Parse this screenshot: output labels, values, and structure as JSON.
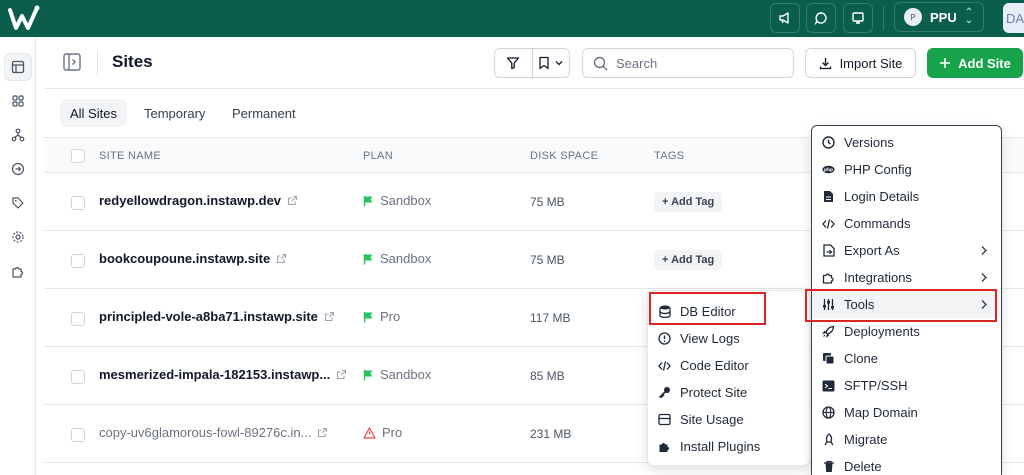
{
  "topbar": {
    "user_initial": "P",
    "user_name": "PPU",
    "second_chip": "DA"
  },
  "header": {
    "title": "Sites",
    "search_placeholder": "Search",
    "import_label": "Import Site",
    "add_label": "Add Site"
  },
  "tabs": [
    {
      "label": "All Sites",
      "active": true
    },
    {
      "label": "Temporary",
      "active": false
    },
    {
      "label": "Permanent",
      "active": false
    }
  ],
  "table": {
    "columns": [
      "SITE NAME",
      "PLAN",
      "DISK SPACE",
      "TAGS"
    ],
    "add_tag_label": "+ Add Tag",
    "rows": [
      {
        "name": "redyellowdragon.instawp.dev",
        "plan": "Sandbox",
        "disk": "75 MB",
        "tag": "+ Add Tag"
      },
      {
        "name": "bookcoupoune.instawp.site",
        "plan": "Sandbox",
        "disk": "75 MB",
        "tag": "+ Add Tag"
      },
      {
        "name": "principled-vole-a8ba71.instawp.site",
        "plan": "Pro",
        "disk": "117 MB"
      },
      {
        "name": "mesmerized-impala-182153.instawp...",
        "plan": "Sandbox",
        "disk": "85 MB"
      },
      {
        "name": "copy-uv6glamorous-fowl-89276c.in...",
        "plan": "Pro",
        "disk": "231 MB"
      }
    ]
  },
  "actions_menu": {
    "items": [
      {
        "label": "Versions",
        "icon": "clock-icon"
      },
      {
        "label": "PHP Config",
        "icon": "php-icon"
      },
      {
        "label": "Login Details",
        "icon": "document-icon"
      },
      {
        "label": "Commands",
        "icon": "code-icon"
      },
      {
        "label": "Export As",
        "icon": "export-icon",
        "submenu": true
      },
      {
        "label": "Integrations",
        "icon": "puzzle-icon",
        "submenu": true
      },
      {
        "label": "Tools",
        "icon": "sliders-icon",
        "submenu": true,
        "highlighted": true
      },
      {
        "label": "Deployments",
        "icon": "rocket-icon"
      },
      {
        "label": "Clone",
        "icon": "copy-icon"
      },
      {
        "label": "SFTP/SSH",
        "icon": "terminal-icon"
      },
      {
        "label": "Map Domain",
        "icon": "globe-icon"
      },
      {
        "label": "Migrate",
        "icon": "migrate-icon"
      },
      {
        "label": "Delete",
        "icon": "trash-icon"
      }
    ]
  },
  "tools_submenu": {
    "items": [
      {
        "label": "DB Editor",
        "icon": "database-icon",
        "highlighted": true
      },
      {
        "label": "View Logs",
        "icon": "alert-circle-icon"
      },
      {
        "label": "Code Editor",
        "icon": "code-icon"
      },
      {
        "label": "Protect Site",
        "icon": "key-icon"
      },
      {
        "label": "Site Usage",
        "icon": "usage-icon"
      },
      {
        "label": "Install Plugins",
        "icon": "puzzle-icon"
      }
    ]
  },
  "colors": {
    "brand": "#0b5e4c",
    "primary": "#16a34a",
    "sandbox": "#22c55e",
    "pro": "#ef4444",
    "highlight_border": "#dc2626"
  }
}
